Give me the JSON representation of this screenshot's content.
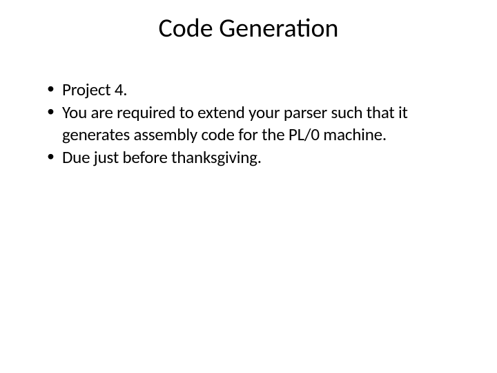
{
  "slide": {
    "title": "Code Generation",
    "bullets": [
      "Project 4.",
      "You are required to extend your parser such that it generates assembly code for the PL/0 machine.",
      "Due just before thanksgiving."
    ]
  }
}
